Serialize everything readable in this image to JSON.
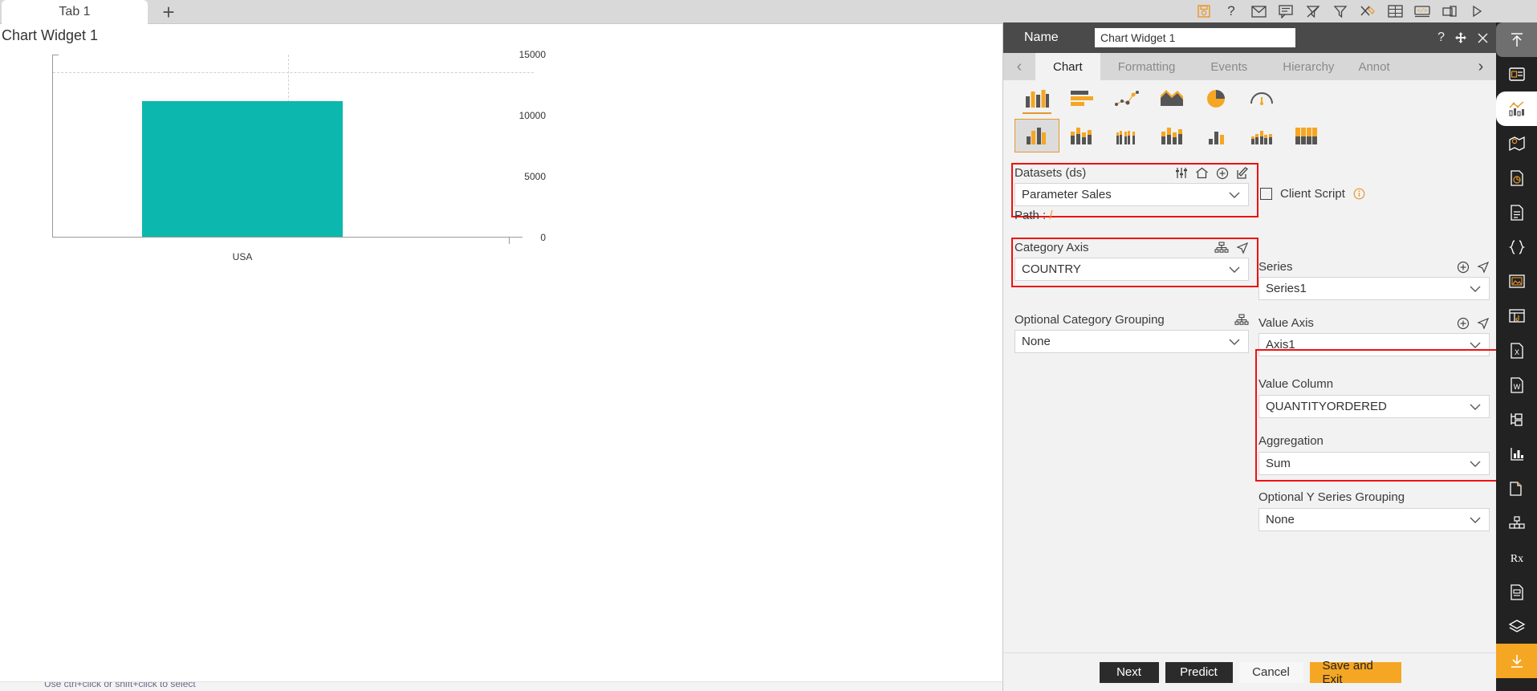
{
  "canvas": {
    "tabs": [
      {
        "label": "Tab 1"
      }
    ],
    "add_tab_label": "+",
    "widget_title": "Chart Widget 1",
    "status_text": "Use ctrl+click or shift+click to select"
  },
  "chart_data": {
    "type": "bar",
    "title": "Chart Widget 1",
    "categories": [
      "USA"
    ],
    "values": [
      10600
    ],
    "series": [
      {
        "name": "Series1",
        "values": [
          10600
        ]
      }
    ],
    "xlabel": "",
    "ylabel": "",
    "ylim": [
      0,
      15000
    ],
    "yticks": [
      0,
      5000,
      10000,
      15000
    ],
    "ytick_labels": [
      "0",
      "5000",
      "10000",
      "15000"
    ],
    "grid": true,
    "legend": "none",
    "bar_color": "#0cb8ad"
  },
  "top_toolbar": {
    "icons": [
      "save-icon",
      "help-icon",
      "mail-icon",
      "comment-icon",
      "clear-filter-icon",
      "filter-icon",
      "tools-icon",
      "table-icon",
      "code-icon",
      "copy-page-icon",
      "run-icon"
    ]
  },
  "properties": {
    "header": {
      "name_label": "Name",
      "name_value": "Chart Widget 1",
      "name_placeholder": "Chart Widget 1",
      "help_icon": "question-mark-icon",
      "move_icon": "move-icon",
      "close_icon": "close-icon"
    },
    "tabs": [
      {
        "label": "Chart",
        "active": true
      },
      {
        "label": "Formatting",
        "active": false
      },
      {
        "label": "Events",
        "active": false
      },
      {
        "label": "Hierarchy",
        "active": false
      },
      {
        "label": "Annot",
        "active": false
      }
    ],
    "tab_prev_icon": "chevron-left-icon",
    "tab_next_icon": "chevron-right-icon",
    "chart_types_row1": [
      "column-chart-icon",
      "bar-chart-icon",
      "scatter-chart-icon",
      "area-chart-icon",
      "pie-chart-icon",
      "gauge-chart-icon"
    ],
    "chart_types_row2": [
      "clustered-column-icon",
      "stacked-column-icon",
      "multi-column-icon",
      "stacked-group-column-icon",
      "small-column-icon",
      "grouped-column-icon",
      "full-stacked-column-icon"
    ],
    "datasets": {
      "label": "Datasets (ds)",
      "value": "Parameter Sales",
      "path_label": "Path : ",
      "path_value": "/",
      "icons": [
        "sliders-icon",
        "home-icon",
        "add-circle-icon",
        "edit-icon"
      ]
    },
    "category_axis": {
      "label": "Category Axis",
      "value": "COUNTRY",
      "icons": [
        "hierarchy-icon",
        "navigate-icon"
      ]
    },
    "category_grouping": {
      "label": "Optional Category Grouping",
      "value": "None",
      "icons": [
        "hierarchy-icon"
      ]
    },
    "client_script": {
      "label": "Client Script",
      "checked": false,
      "info_icon": "info-icon"
    },
    "series": {
      "label": "Series",
      "value": "Series1",
      "icons": [
        "add-circle-icon",
        "navigate-icon"
      ]
    },
    "value_axis": {
      "label": "Value Axis",
      "value": "Axis1",
      "icons": [
        "add-circle-icon",
        "navigate-icon"
      ]
    },
    "value_column": {
      "label": "Value Column",
      "value": "QUANTITYORDERED"
    },
    "aggregation": {
      "label": "Aggregation",
      "value": "Sum"
    },
    "y_series_grouping": {
      "label": "Optional Y Series Grouping",
      "value": "None"
    },
    "footer": {
      "next": "Next",
      "predict": "Predict",
      "cancel": "Cancel",
      "save_and_exit": "Save and Exit"
    },
    "highlight_color": "#ee1111",
    "accent_color": "#f5a623"
  },
  "rail": {
    "items": [
      "collapse-panel-icon",
      "widget-icon",
      "chart-icon",
      "map-icon",
      "report-pie-icon",
      "document-icon",
      "braces-icon",
      "image-icon",
      "calendar-icon",
      "excel-icon",
      "word-icon",
      "tree-icon",
      "bar-data-icon",
      "copy-icon",
      "cube-icon",
      "prescription-icon",
      "form-icon",
      "layers-icon",
      "download-icon"
    ]
  }
}
